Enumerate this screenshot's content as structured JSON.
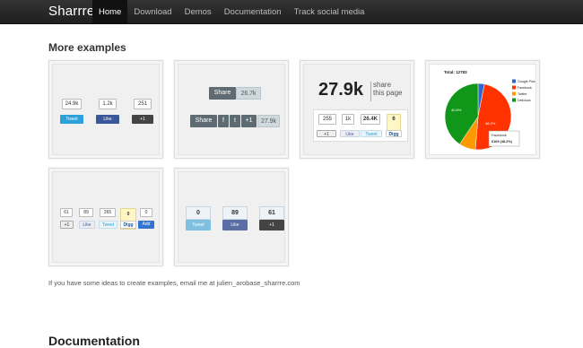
{
  "nav": {
    "brand": "Sharrre",
    "items": [
      {
        "label": "Home",
        "active": true
      },
      {
        "label": "Download",
        "active": false
      },
      {
        "label": "Demos",
        "active": false
      },
      {
        "label": "Documentation",
        "active": false
      },
      {
        "label": "Track social media",
        "active": false
      }
    ]
  },
  "section": {
    "title": "More examples"
  },
  "ex1": {
    "counts": [
      "24.9k",
      "1.2k",
      "251"
    ],
    "labels": [
      "Tweet",
      "Like",
      "+1"
    ]
  },
  "ex2": {
    "share": "Share",
    "count_top": "26.7k",
    "buttons": [
      "f",
      "t",
      "+1"
    ],
    "count_bottom": "27.9k"
  },
  "ex3": {
    "big_count": "27.9k",
    "caption_1": "share",
    "caption_2": "this page",
    "counts": [
      "255",
      "1k",
      "26.4K",
      "6"
    ],
    "labels": [
      "+1",
      "Like",
      "Tweet",
      "Digg"
    ]
  },
  "ex4": {
    "chart_data": {
      "type": "pie",
      "title": "Total: 12783",
      "series": [
        {
          "name": "Google Plus",
          "percent": 3.1,
          "color": "#3366cc"
        },
        {
          "name": "Facebook",
          "percent": 48.2,
          "color": "#ff3300"
        },
        {
          "name": "Twitter",
          "percent": 8.1,
          "color": "#ff9900"
        },
        {
          "name": "Delicious",
          "percent": 40.6,
          "color": "#109618"
        }
      ],
      "slice_labels": [
        "40.6%",
        "48.2%"
      ],
      "tooltip_title": "Facebook",
      "tooltip_value": "6169 (48.2%)",
      "legend_position": "right"
    }
  },
  "ex5": {
    "counts": [
      "61",
      "89",
      "265",
      "0",
      "0"
    ],
    "labels": [
      "+1",
      "Like",
      "Tweet",
      "Digg",
      "Add"
    ]
  },
  "ex6": {
    "counts": [
      "0",
      "89",
      "61"
    ],
    "labels": [
      "Tweet",
      "Like",
      "+1"
    ]
  },
  "footer": {
    "text": "If you have some ideas to create examples, email me at julien_arobase_sharrre.com"
  },
  "next_section": {
    "title": "Documentation"
  },
  "colors": {
    "twitter": "#2ba0d9",
    "facebook": "#3b5998",
    "gplus": "#444",
    "digg": "#fde98a"
  }
}
